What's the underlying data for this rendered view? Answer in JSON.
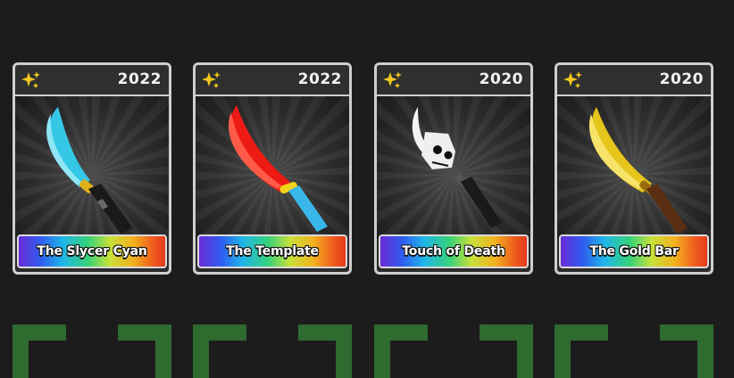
{
  "colors": {
    "background": "#1c1c1c",
    "card_border": "#cfcfcf",
    "bracket_green": "#2f6b2f"
  },
  "cards": [
    {
      "year": "2022",
      "name": "The Slycer Cyan",
      "icon": "sparkle-icon",
      "item_image": "cyan-knife",
      "blade_color": "#35c8e6",
      "guard_color": "#e0b21a",
      "handle_color": "#1a1a1a"
    },
    {
      "year": "2022",
      "name": "The Template",
      "icon": "sparkle-icon",
      "item_image": "red-cyan-knife",
      "blade_color": "#ee1a14",
      "guard_color": "#f0d31a",
      "handle_color": "#39b7e8"
    },
    {
      "year": "2020",
      "name": "Touch of Death",
      "icon": "sparkle-icon",
      "item_image": "skull-knife",
      "blade_color": "#efefef",
      "guard_color": "#555555",
      "handle_color": "#1a1a1a"
    },
    {
      "year": "2020",
      "name": "The Gold Bar",
      "icon": "sparkle-icon",
      "item_image": "gold-knife",
      "blade_color": "#e6c51c",
      "guard_color": "#9a6a12",
      "handle_color": "#5a2e12"
    }
  ]
}
